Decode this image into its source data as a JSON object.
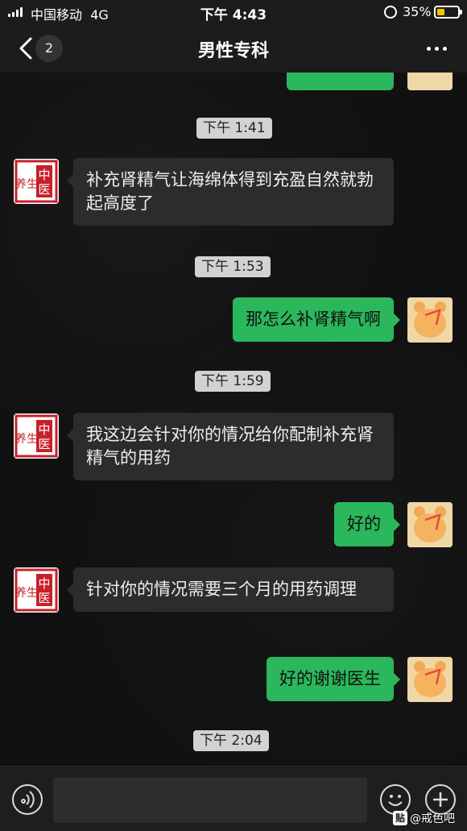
{
  "status_bar": {
    "carrier": "中国移动",
    "network": "4G",
    "time": "下午 4:43",
    "battery_percent": "35%",
    "battery_level": 0.35
  },
  "nav": {
    "back_icon": "chevron-left-icon",
    "unread_count": "2",
    "title": "男性专科",
    "more_icon": "ellipsis-icon"
  },
  "messages": [
    {
      "type": "timestamp",
      "text": "下午 1:41"
    },
    {
      "type": "received",
      "text": "补充肾精气让海绵体得到充盈自然就勃起高度了"
    },
    {
      "type": "timestamp",
      "text": "下午 1:53"
    },
    {
      "type": "sent",
      "text": "那怎么补肾精气啊"
    },
    {
      "type": "timestamp",
      "text": "下午 1:59"
    },
    {
      "type": "received",
      "text": "我这边会针对你的情况给你配制补充肾精气的用药"
    },
    {
      "type": "sent",
      "text": "好的"
    },
    {
      "type": "received",
      "text": "针对你的情况需要三个月的用药调理"
    },
    {
      "type": "sent",
      "text": "好的谢谢医生"
    },
    {
      "type": "timestamp",
      "text": "下午 2:04"
    }
  ],
  "doctor_avatar": {
    "line1": "中",
    "line2": "医",
    "script": "养生"
  },
  "input_bar": {
    "voice_icon": "voice-icon",
    "emoji_icon": "emoji-icon",
    "plus_icon": "plus-icon",
    "placeholder": ""
  },
  "watermark": {
    "badge": "贴",
    "text": "@戒色吧"
  },
  "colors": {
    "sent_bubble": "#2bb75b",
    "received_bubble": "#2c2c2c",
    "background": "#111111",
    "battery_fill": "#f2c700"
  }
}
